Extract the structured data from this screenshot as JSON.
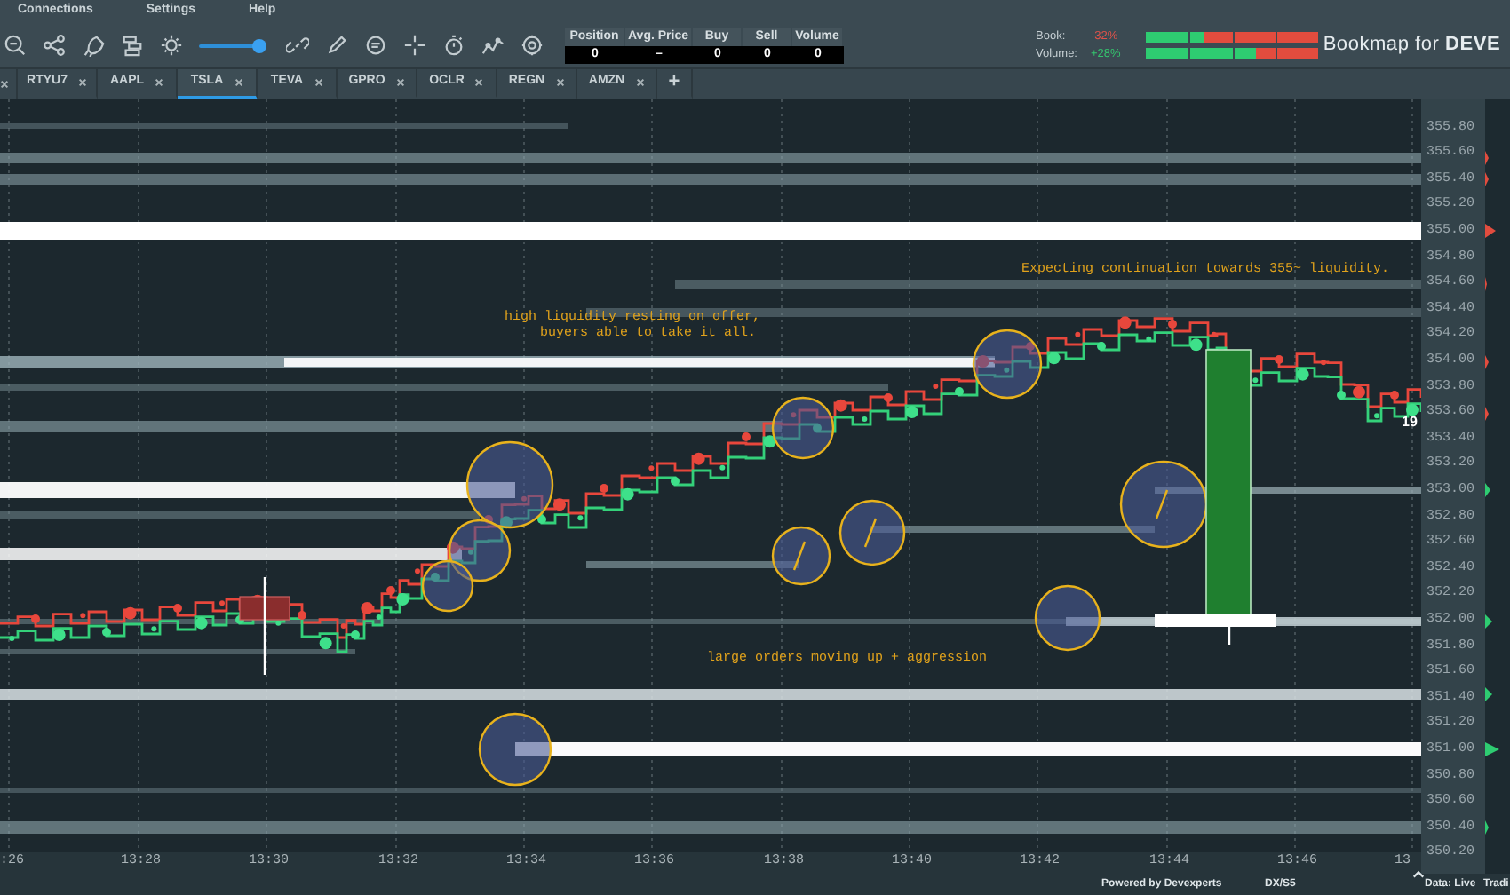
{
  "menu": [
    "Connections",
    "Settings",
    "Help"
  ],
  "toolbar": {
    "slider": {
      "level": 0.95
    }
  },
  "position_table": {
    "columns": [
      "Position",
      "Avg. Price",
      "Buy",
      "Sell",
      "Volume"
    ],
    "values": [
      "0",
      "–",
      "0",
      "0",
      "0"
    ]
  },
  "sentiment": [
    {
      "label": "Book:",
      "value": "-32%",
      "color": "#e0524a",
      "level": 0.34
    },
    {
      "label": "Volume:",
      "value": "+28%",
      "color": "#35c46e",
      "level": 0.64
    }
  ],
  "brand": "Bookmap for **DEVE**",
  "tabs": [
    {
      "label": "RTYU7",
      "selected": false
    },
    {
      "label": "AAPL",
      "selected": false
    },
    {
      "label": "TSLA",
      "selected": true
    },
    {
      "label": "TEVA",
      "selected": false
    },
    {
      "label": "GPRO",
      "selected": false
    },
    {
      "label": "OCLR",
      "selected": false
    },
    {
      "label": "REGN",
      "selected": false
    },
    {
      "label": "AMZN",
      "selected": false
    },
    {
      "label": "+",
      "selected": false
    }
  ],
  "chart": {
    "annotations": [
      "high liquidity resting on offer,",
      "buyers able to take it all.",
      "Expecting continuation towards 355~ liquidity.",
      "large orders moving up + aggression"
    ],
    "last_trade_size": "19",
    "price_labels": [
      "355.80",
      "355.60",
      "355.40",
      "355.20",
      "355.00",
      "354.80",
      "354.60",
      "354.40",
      "354.20",
      "354.00",
      "353.80",
      "353.60",
      "353.40",
      "353.20",
      "353.00",
      "352.80",
      "352.60",
      "352.40",
      "352.20",
      "352.00",
      "351.80",
      "351.60",
      "351.40",
      "351.20",
      "351.00",
      "350.80",
      "350.60",
      "350.40",
      "350.20"
    ],
    "time_labels": [
      ":26",
      "13:28",
      "13:30",
      "13:32",
      "13:34",
      "13:36",
      "13:38",
      "13:40",
      "13:42",
      "13:44",
      "13:46",
      "13"
    ]
  },
  "status_bar": [
    "Powered by Devexperts",
    "DX/S5",
    "Data: Live",
    "Tradi"
  ]
}
